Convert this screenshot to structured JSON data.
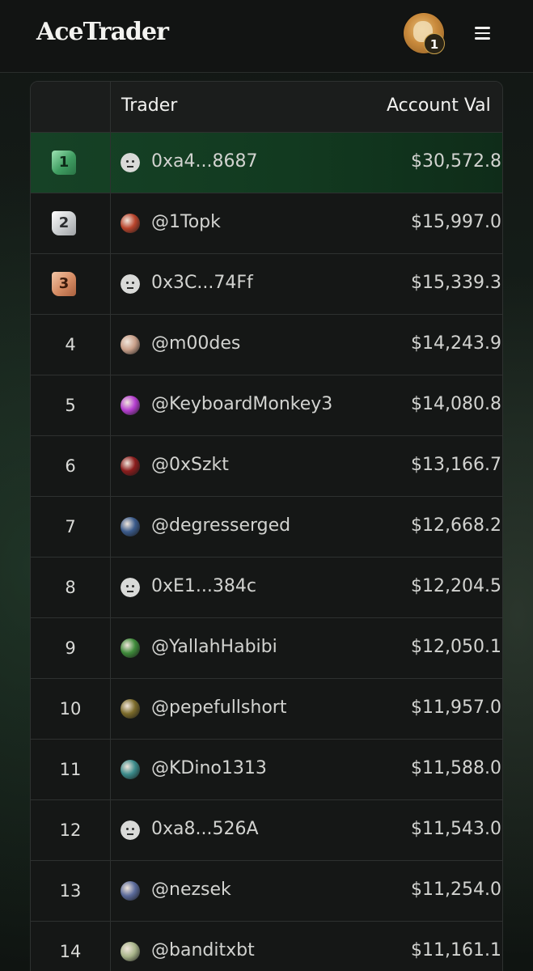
{
  "header": {
    "logo": "AceTrader",
    "profile_badge": "1"
  },
  "table": {
    "columns": {
      "rank": "",
      "trader": "Trader",
      "value": "Account Val"
    },
    "rows": [
      {
        "rank": "1",
        "medal": "gold",
        "avatar": "anon-face-icon",
        "name": "0xa4...8687",
        "value": "$30,572.8"
      },
      {
        "rank": "2",
        "medal": "silver",
        "avatar": "avatar-image",
        "avatar_color": "#b8442c",
        "name": "@1Topk",
        "value": "$15,997.0"
      },
      {
        "rank": "3",
        "medal": "bronze",
        "avatar": "anon-face-icon",
        "name": "0x3C...74Ff",
        "value": "$15,339.3"
      },
      {
        "rank": "4",
        "medal": null,
        "avatar": "avatar-image",
        "avatar_color": "#c9a08a",
        "name": "@m00des",
        "value": "$14,243.9"
      },
      {
        "rank": "5",
        "medal": null,
        "avatar": "avatar-image",
        "avatar_color": "#b43ecf",
        "name": "@KeyboardMonkey3",
        "value": "$14,080.8"
      },
      {
        "rank": "6",
        "medal": null,
        "avatar": "avatar-image",
        "avatar_color": "#8a1c1c",
        "name": "@0xSzkt",
        "value": "$13,166.7"
      },
      {
        "rank": "7",
        "medal": null,
        "avatar": "avatar-image",
        "avatar_color": "#3a5a8a",
        "name": "@degresserged",
        "value": "$12,668.2"
      },
      {
        "rank": "8",
        "medal": null,
        "avatar": "anon-face-icon",
        "name": "0xE1...384c",
        "value": "$12,204.5"
      },
      {
        "rank": "9",
        "medal": null,
        "avatar": "avatar-image",
        "avatar_color": "#3e8a3a",
        "name": "@YallahHabibi",
        "value": "$12,050.1"
      },
      {
        "rank": "10",
        "medal": null,
        "avatar": "avatar-image",
        "avatar_color": "#7a6a2a",
        "name": "@pepefullshort",
        "value": "$11,957.0"
      },
      {
        "rank": "11",
        "medal": null,
        "avatar": "avatar-image",
        "avatar_color": "#3a8a8a",
        "name": "@KDino1313",
        "value": "$11,588.0"
      },
      {
        "rank": "12",
        "medal": null,
        "avatar": "anon-face-icon",
        "name": "0xa8...526A",
        "value": "$11,543.0"
      },
      {
        "rank": "13",
        "medal": null,
        "avatar": "avatar-image",
        "avatar_color": "#5a6a9a",
        "name": "@nezsek",
        "value": "$11,254.0"
      },
      {
        "rank": "14",
        "medal": null,
        "avatar": "avatar-image",
        "avatar_color": "#a8b48a",
        "name": "@banditxbt",
        "value": "$11,161.1"
      }
    ]
  }
}
